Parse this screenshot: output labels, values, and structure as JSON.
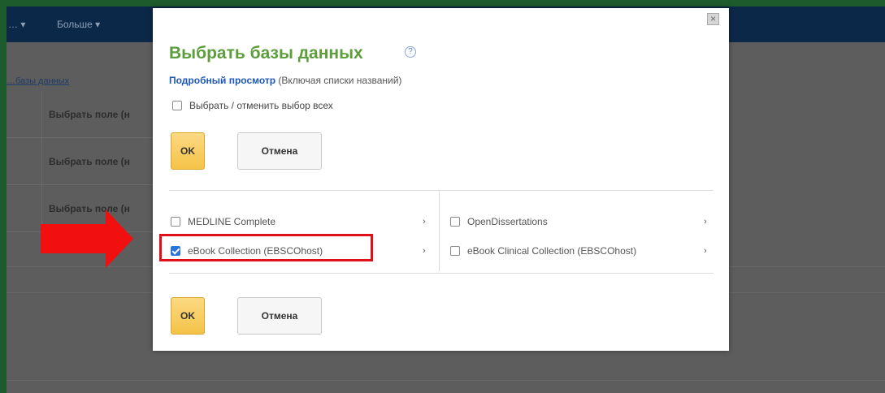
{
  "nav": {
    "item_a": "… ▾",
    "item_b": "Больше ▾"
  },
  "background": {
    "breadcrumb": "…базы данных",
    "row_label": "Выбрать поле (н"
  },
  "modal": {
    "title": "Выбрать базы данных",
    "help_symbol": "?",
    "close_symbol": "×",
    "detail_link": "Подробный просмотр",
    "detail_suffix": " (Включая списки названий)",
    "select_all": "Выбрать / отменить выбор всех",
    "ok_label": "OK",
    "cancel_label": "Отмена",
    "chevron": "›",
    "databases": [
      {
        "name": "MEDLINE Complete",
        "checked": false
      },
      {
        "name": "eBook Collection (EBSCOhost)",
        "checked": true
      },
      {
        "name": "OpenDissertations",
        "checked": false
      },
      {
        "name": "eBook Clinical Collection (EBSCOhost)",
        "checked": false
      }
    ]
  },
  "colors": {
    "title_green": "#5c9e3c",
    "link_blue": "#1f58b8",
    "ok_yellow": "#f4c347",
    "highlight_red": "#e0101a",
    "frame_green": "#1e5b2c"
  }
}
